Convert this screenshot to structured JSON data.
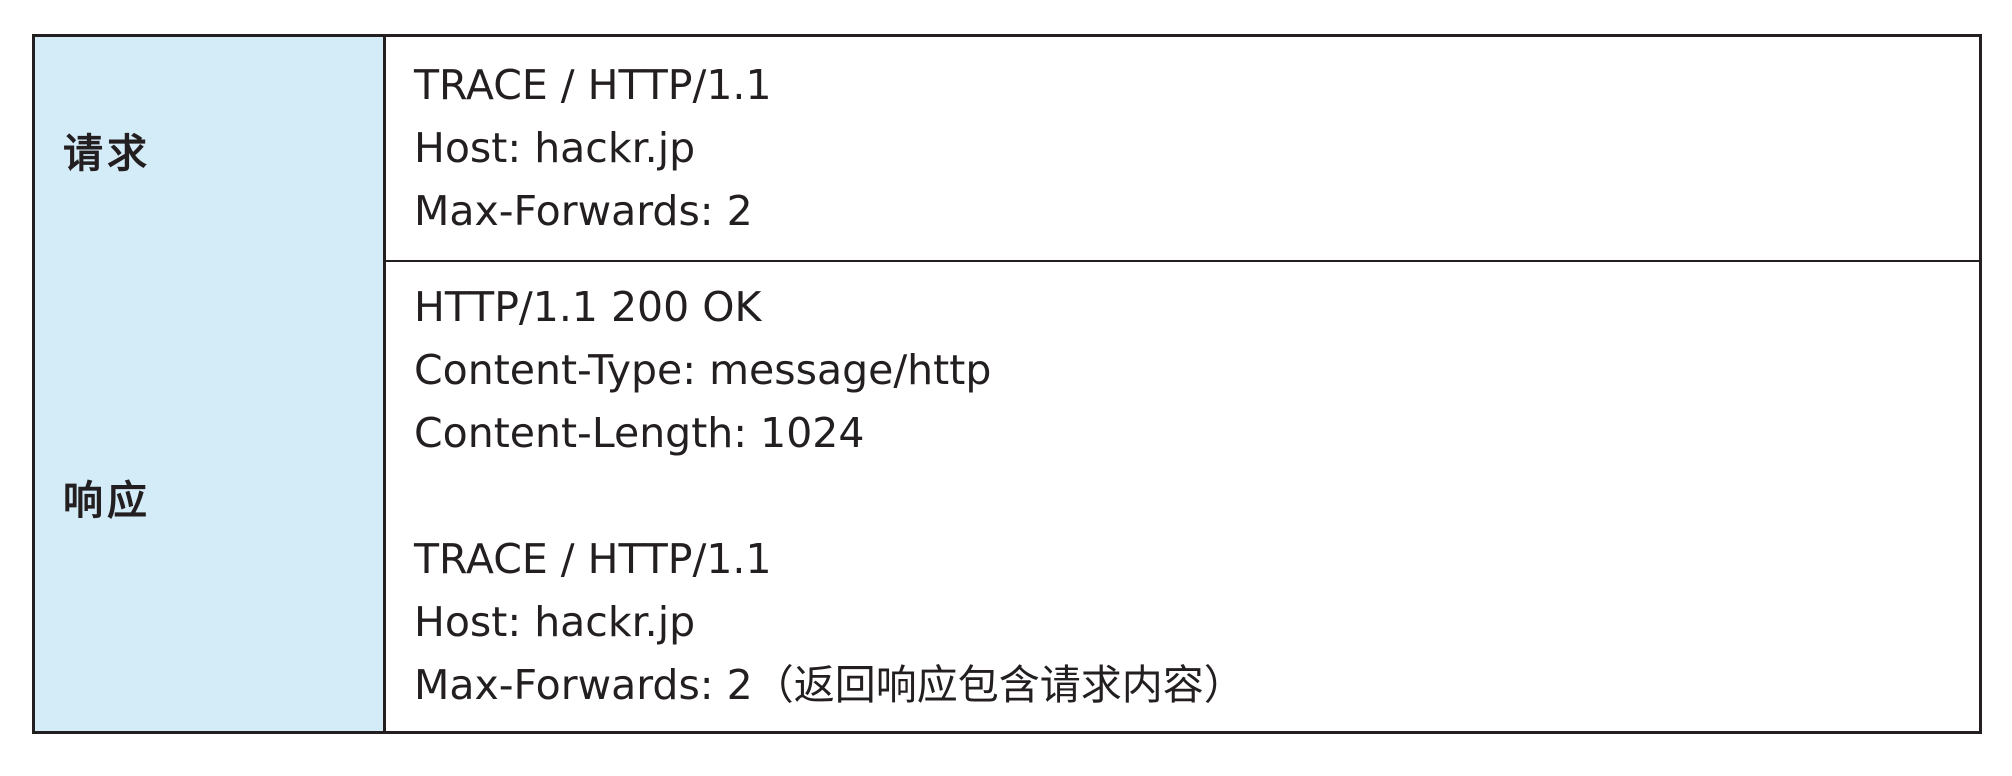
{
  "rows": [
    {
      "label": "请求",
      "lines": [
        "TRACE / HTTP/1.1",
        "Host: hackr.jp",
        "Max-Forwards: 2"
      ]
    },
    {
      "label": "响应",
      "lines": [
        "HTTP/1.1 200 OK",
        "Content-Type: message/http",
        "Content-Length: 1024",
        "",
        "TRACE / HTTP/1.1",
        "Host: hackr.jp",
        "Max-Forwards: 2（返回响应包含请求内容）"
      ]
    }
  ]
}
